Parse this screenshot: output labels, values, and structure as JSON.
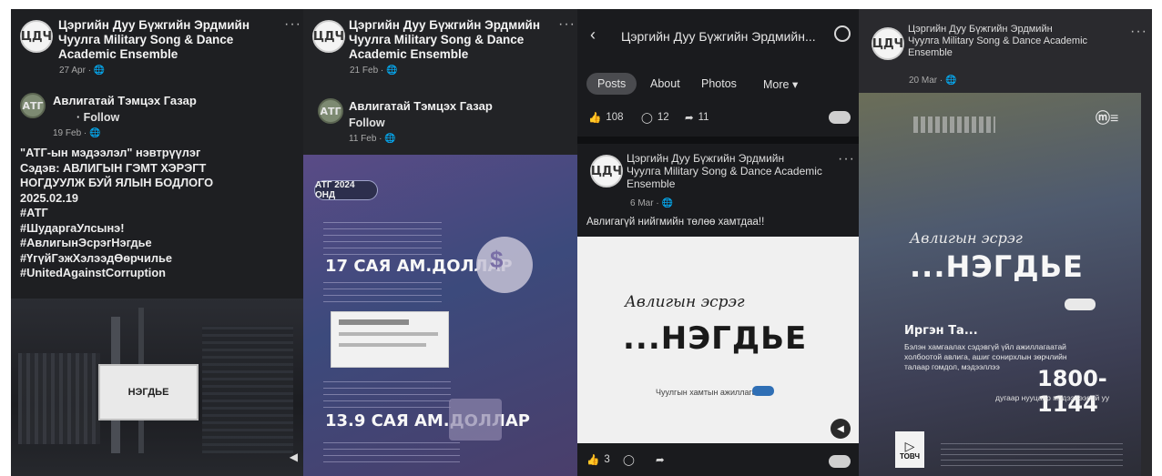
{
  "panels": {
    "p1": {
      "page_name": "Цэргийн Дуу Бүжгийн Эрдмийн Чуулга Military Song & Dance Academic Ensemble",
      "page_name_l1": "Цэргийн Дуу Бүжгийн Эрдмийн",
      "page_name_l2": "Чуулга Military Song & Dance",
      "page_name_l3": "Academic Ensemble",
      "date": "27 Apr · 🌐",
      "shared_from": "Авлигатай Тэмцэх Газар",
      "follow": "· Follow",
      "shared_date": "19 Feb · 🌐",
      "post_lines": [
        "\"АТГ-ын мэдээлэл\" нэвтрүүлэг",
        "Сэдэв: АВЛИГЫН ГЭМТ ХЭРЭГТ",
        "НОГДУУЛЖ БУЙ ЯЛЫН БОДЛОГО",
        "2025.02.19",
        "#АТГ",
        "#ШударгаУлсынэ!",
        "#АвлигынЭсрэгНэгдье",
        "#ҮгүйГэжХэлээдӨөрчилье",
        "#UnitedAgainstCorruption"
      ],
      "screen_text": "НЭГДЬЕ"
    },
    "p2": {
      "page_name_l1": "Цэргийн Дуу Бүжгийн Эрдмийн",
      "page_name_l2": "Чуулга Military Song & Dance",
      "page_name_l3": "Academic Ensemble",
      "date": "21 Feb · 🌐",
      "shared_from": "Авлигатай Тэмцэх Газар",
      "follow": "Follow",
      "shared_date": "11 Feb · 🌐",
      "badge": "АТГ 2024 ОНД",
      "amount1": "17 САЯ АМ.ДОЛЛАР",
      "amount2": "13.9 САЯ АМ.ДОЛЛАР"
    },
    "p3": {
      "header_title": "Цэргийн Дуу Бүжгийн Эрдмийн...",
      "tabs": [
        "Posts",
        "About",
        "Photos",
        "More ▾"
      ],
      "likes": "108",
      "comments": "12",
      "shares": "11",
      "post_page_l1": "Цэргийн Дуу Бүжгийн Эрдмийн",
      "post_page_l2": "Чуулга Military Song & Dance Academic",
      "post_page_l3": "Ensemble",
      "post_date": "6 Mar · 🌐",
      "post_text": "Авлигагүй нийгмийн төлөө хамтдаа!!",
      "script_text": "Авлигын эсрэг",
      "brand_text": "...НЭГДЬЕ",
      "bottom_caption": "Чуулгын хамтын ажиллагаа",
      "bottom_likes": "3"
    },
    "p4": {
      "page_name_l1": "Цэргийн Дуу Бүжгийн Эрдмийн",
      "page_name_l2": "Чуулга Military Song & Dance Academic",
      "page_name_l3": "Ensemble",
      "date": "20 Mar · 🌐",
      "script_text": "Авлигын эсрэг",
      "brand_text": "...НЭГДЬЕ",
      "citizen": "Иргэн Та...",
      "body_l1": "Бэлэн хамгаалах сэдэвгүй үйл ажиллагаатай",
      "body_l2": "холбоотой авлига, ашиг сонирхлын зөрчлийн",
      "body_l3": "талаар гомдол, мэдээллээ",
      "phone": "1800-1144",
      "after_phone": "дугаар нууцаар мэдээлээрэй уу",
      "tovch": "ТОВЧ"
    }
  },
  "colors": {
    "bg_dark": "#1e1f22",
    "text_light": "#f2f2f2",
    "accent_blue": "#2f6fb5"
  }
}
